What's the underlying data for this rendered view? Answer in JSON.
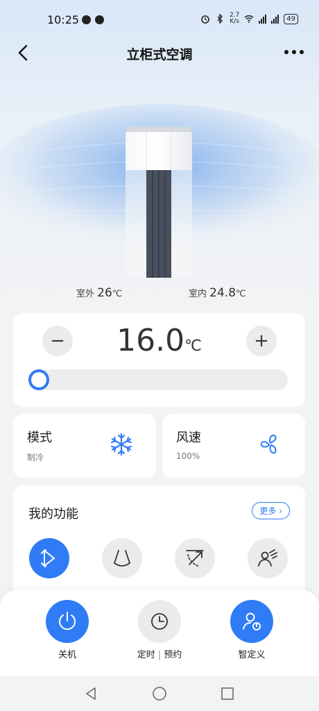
{
  "status_bar": {
    "time": "10:25",
    "speed_top": "2.7",
    "speed_bottom": "K/s",
    "battery": "49"
  },
  "header": {
    "title": "立柜式空调"
  },
  "environment": {
    "outdoor_label": "室外",
    "outdoor_value": "26",
    "indoor_label": "室内",
    "indoor_value": "24.8",
    "unit": "℃"
  },
  "temperature": {
    "minus_label": "−",
    "plus_label": "+",
    "value": "16.0",
    "unit": "℃"
  },
  "mode": {
    "title": "模式",
    "value": "制冷"
  },
  "wind": {
    "title": "风速",
    "value": "100%"
  },
  "functions": {
    "title": "我的功能",
    "more_label": "更多",
    "more_chevron": "›"
  },
  "bottom": {
    "power_label": "关机",
    "timer_label": "定时",
    "timer_sep": "|",
    "schedule_label": "预约",
    "custom_label": "智定义"
  },
  "colors": {
    "accent": "#2f7cf6",
    "background": "#f2f3f5"
  }
}
